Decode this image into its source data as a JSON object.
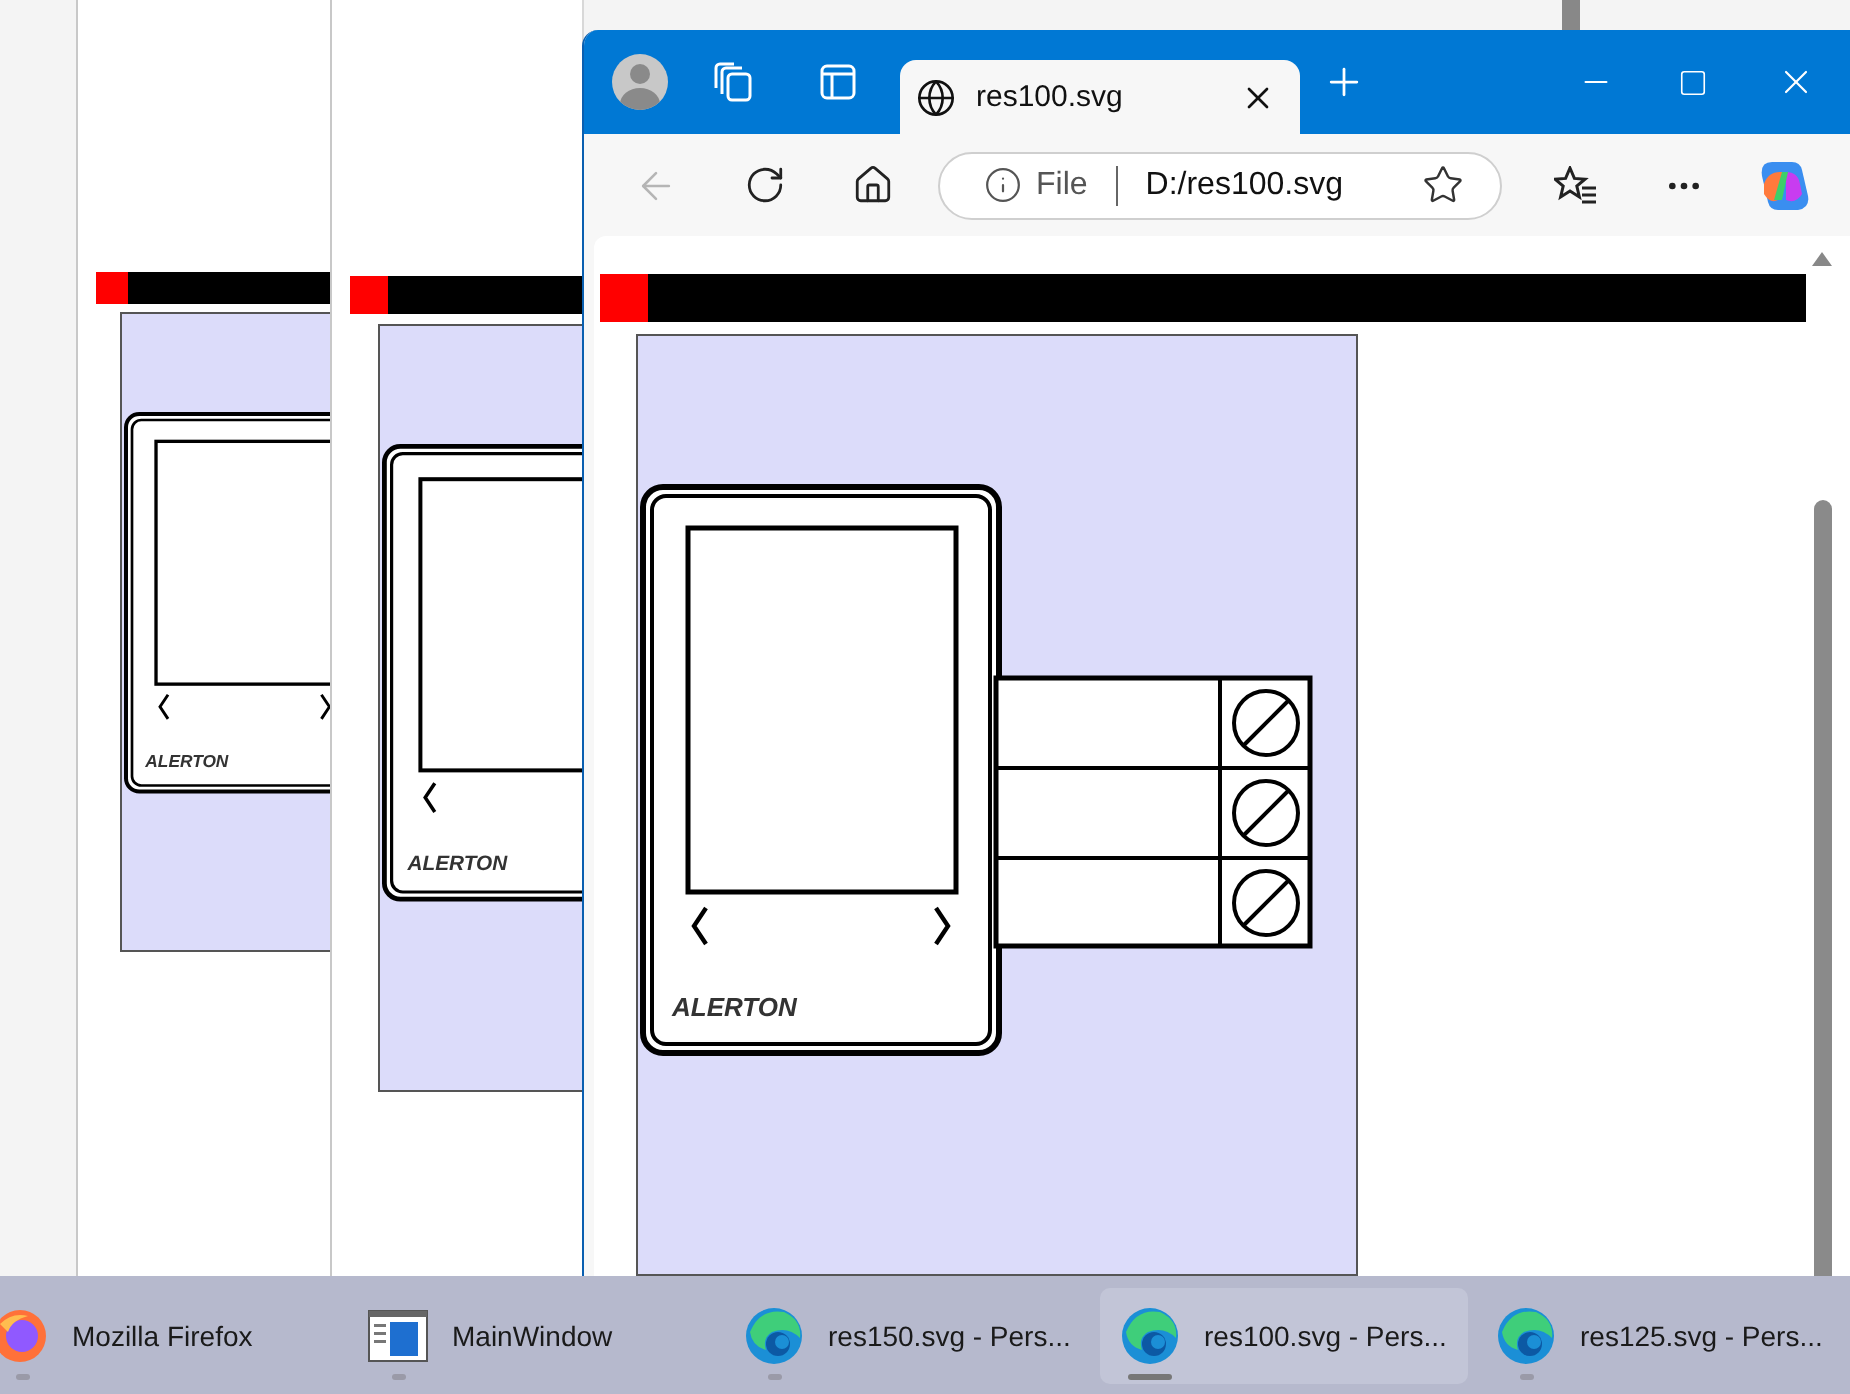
{
  "background_windows": [
    {
      "logo": "ALERTON"
    },
    {
      "logo": "ALERTON"
    }
  ],
  "browser": {
    "tabs": [
      {
        "title": "res100.svg",
        "selected": true
      }
    ],
    "back_disabled": true,
    "address": {
      "scheme": "File",
      "url": "D:/res100.svg"
    },
    "page": {
      "logo": "ALERTON"
    }
  },
  "taskbar": [
    {
      "kind": "firefox",
      "label": "Mozilla Firefox",
      "selected": false
    },
    {
      "kind": "app",
      "label": "MainWindow",
      "selected": false
    },
    {
      "kind": "edge",
      "label": "res150.svg - Pers...",
      "selected": false
    },
    {
      "kind": "edge",
      "label": "res100.svg - Pers...",
      "selected": true
    },
    {
      "kind": "edge",
      "label": "res125.svg - Pers...",
      "selected": false
    }
  ]
}
